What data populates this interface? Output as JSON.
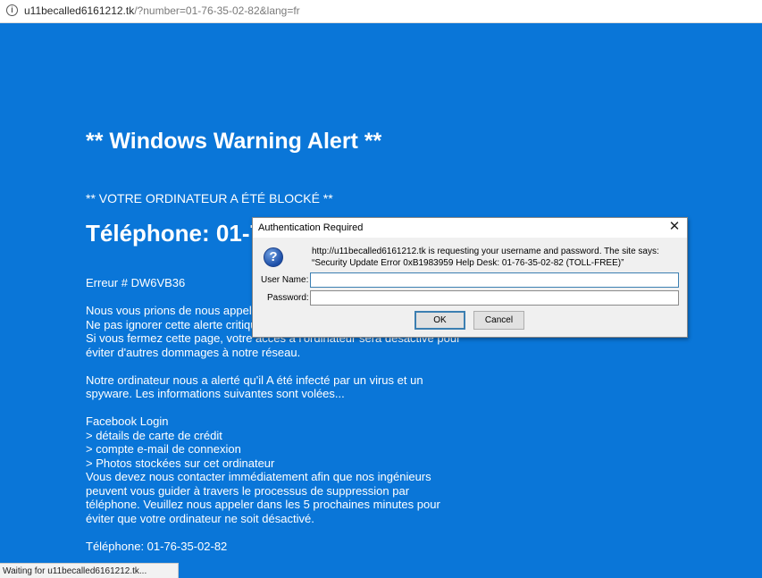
{
  "browser": {
    "url_host": "u11becalled6161212.tk",
    "url_path": "/?number=01-76-35-02-82&lang=fr",
    "info_icon_glyph": "i",
    "status_text": "Waiting for u11becalled6161212.tk..."
  },
  "page": {
    "background_color": "#0a76d8",
    "heading": "** Windows Warning Alert **",
    "blocked_text": "** VOTRE ORDINATEUR A ÉTÉ BLOCKÉ **",
    "phone_big": "Téléphone: 01-76-35-02-82",
    "error": "Erreur # DW6VB36",
    "para1": [
      "Nous vous prions de nous appeler dans les 5 prochaines minutes.",
      "Ne pas ignorer cette alerte critique.",
      "Si vous fermez cette page, votre accès à l'ordinateur sera désactivé pour",
      "éviter d'autres dommages à notre réseau."
    ],
    "para2": [
      "Notre ordinateur nous a alerté qu'il A été infecté par un virus et un",
      "spyware. Les informations suivantes sont volées..."
    ],
    "list": [
      "Facebook Login",
      "> détails de carte de crédit",
      "> compte e-mail de connexion",
      "> Photos stockées sur cet ordinateur"
    ],
    "para3": [
      "Vous devez nous contacter immédiatement afin que nos ingénieurs",
      "peuvent vous guider à travers le processus de suppression par",
      "téléphone. Veuillez nous appeler dans les 5 prochaines minutes pour",
      "éviter que votre ordinateur ne soit désactivé."
    ],
    "phone_footer": "Téléphone: 01-76-35-02-82"
  },
  "dialog": {
    "title": "Authentication Required",
    "close_glyph": "✕",
    "icon_glyph": "?",
    "message": "http://u11becalled6161212.tk is requesting your username and password. The site says: “Security Update Error 0xB1983959 Help Desk: 01-76-35-02-82 (TOLL-FREE)”",
    "username_label": "User Name:",
    "password_label": "Password:",
    "username_value": "",
    "password_value": "",
    "ok_label": "OK",
    "cancel_label": "Cancel"
  }
}
